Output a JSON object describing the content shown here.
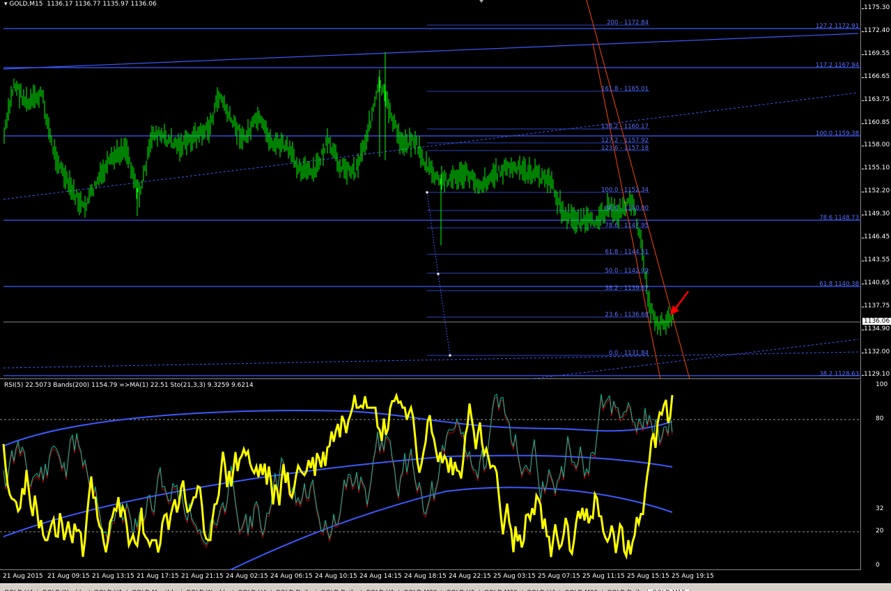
{
  "header": {
    "symbol": "GOLD,M15",
    "ohlc": "1136.17 1136.77 1135.97 1136.06"
  },
  "indicator_header": "RSI(5) 22.5073  Bands(200) 1154.79  =>MA(1) 22.51  Sto(21,3,3) 9.3259 9.6214",
  "current_price": "1136.06",
  "price_axis": [
    "1175.30",
    "1172.40",
    "1169.55",
    "1166.65",
    "1163.75",
    "1160.85",
    "1158.00",
    "1155.10",
    "1152.20",
    "1149.30",
    "1146.45",
    "1143.55",
    "1140.65",
    "1137.75",
    "1134.90",
    "1132.00",
    "1129.10"
  ],
  "sub_axis": [
    "100",
    "80",
    "32",
    "20",
    "0"
  ],
  "time_axis": [
    "21 Aug 2015",
    "21 Aug 09:15",
    "21 Aug 13:15",
    "21 Aug 17:15",
    "21 Aug 21:15",
    "24 Aug 02:15",
    "24 Aug 06:15",
    "24 Aug 10:15",
    "24 Aug 14:15",
    "24 Aug 18:15",
    "24 Aug 22:15",
    "25 Aug 03:15",
    "25 Aug 07:15",
    "25 Aug 11:15",
    "25 Aug 15:15",
    "25 Aug 19:15"
  ],
  "fib_right": [
    "127.2  1172.91",
    "117.2  1167.94",
    "100.0  1159.38",
    "78.6  1148.73",
    "61.8  1140.38",
    "38.2  1128.63"
  ],
  "fib_mid": [
    "200 - 1172.84",
    "161.8 - 1165.01",
    "138.2 - 1160.17",
    "127.2 - 1157.92",
    "123.6 - 1157.18",
    "100.0 - 1152.34",
    "88.6 - 1150.00",
    "78.6 - 1147.95",
    "61.8 - 1144.51",
    "50.0 - 1142.09",
    "38.2 - 1139.67",
    "23.6 - 1136.68",
    "0.0 - 1131.84"
  ],
  "tabs": [
    "GOLD,H4",
    "GOLD,Weekly",
    "GOLD,H1",
    "GOLD,Monthly",
    "GOLD,Weekly",
    "GOLD,H4",
    "GOLD,Daily",
    "GOLD,Daily",
    "GOLD,H1",
    "GOLD,M30",
    "GOLD,H1",
    "GOLD,M30",
    "GOLD,H4",
    "GOLD,M30",
    "GOLD,Daily",
    "GOLD,M15"
  ],
  "colors": {
    "bg": "#000000",
    "candle": "#00ff00",
    "fib": "#3b5bff",
    "channel": "#ff4500",
    "rsi": "#ffff00",
    "bands": "#3b5bff",
    "arrow": "#ff0000"
  }
}
